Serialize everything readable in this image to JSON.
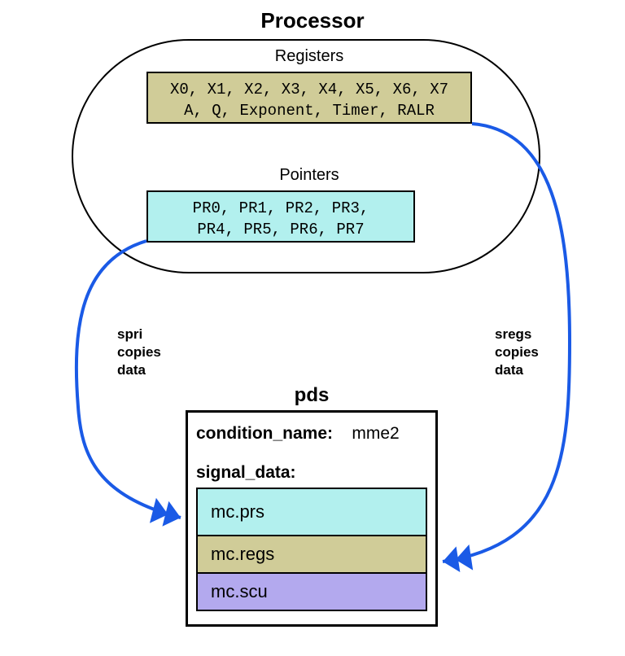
{
  "title": "Processor",
  "processor": {
    "registers": {
      "label": "Registers",
      "line1": "X0, X1, X2, X3, X4, X5, X6, X7",
      "line2": "A, Q, Exponent, Timer, RALR"
    },
    "pointers": {
      "label": "Pointers",
      "line1": "PR0, PR1, PR2, PR3,",
      "line2": "PR4, PR5, PR6, PR7"
    }
  },
  "arrows": {
    "left": {
      "l1": "spri",
      "l2": "copies",
      "l3": "data"
    },
    "right": {
      "l1": "sregs",
      "l2": "copies",
      "l3": "data"
    }
  },
  "pds": {
    "title": "pds",
    "condition_name_label": "condition_name:",
    "condition_name_value": "mme2",
    "signal_data_label": "signal_data:",
    "segments": {
      "prs": "mc.prs",
      "regs": "mc.regs",
      "scu": "mc.scu"
    }
  },
  "colors": {
    "registers": "#d0cc98",
    "pointers": "#b2f0ee",
    "scu": "#b3a9ee",
    "arrow": "#1a5ae6"
  }
}
